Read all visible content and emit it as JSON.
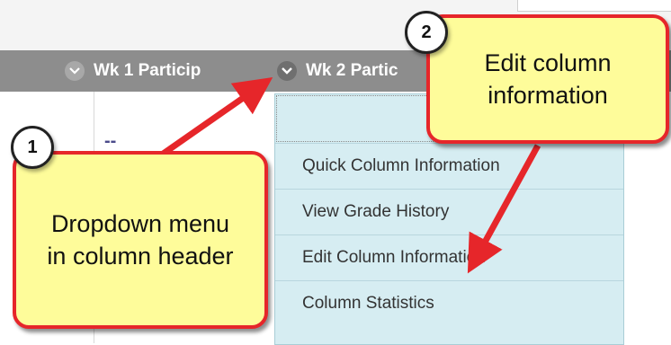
{
  "grid": {
    "columns": [
      {
        "label": "Wk 1 Particip",
        "icon": "chevron-down-icon"
      },
      {
        "label": "Wk 2 Partic",
        "icon": "chevron-down-icon"
      }
    ],
    "cells": [
      "--",
      "--"
    ]
  },
  "menu": {
    "items": [
      "Quick Column Information",
      "View Grade History",
      "Edit Column Information",
      "Column Statistics"
    ]
  },
  "callouts": [
    {
      "number": "1",
      "text": "Dropdown menu in column header"
    },
    {
      "number": "2",
      "text": "Edit column information"
    }
  ],
  "colors": {
    "callout_fill": "#fefc9a",
    "callout_border": "#e6262a",
    "menu_bg": "#d6edf2",
    "header_bg": "#8d8d8d"
  }
}
